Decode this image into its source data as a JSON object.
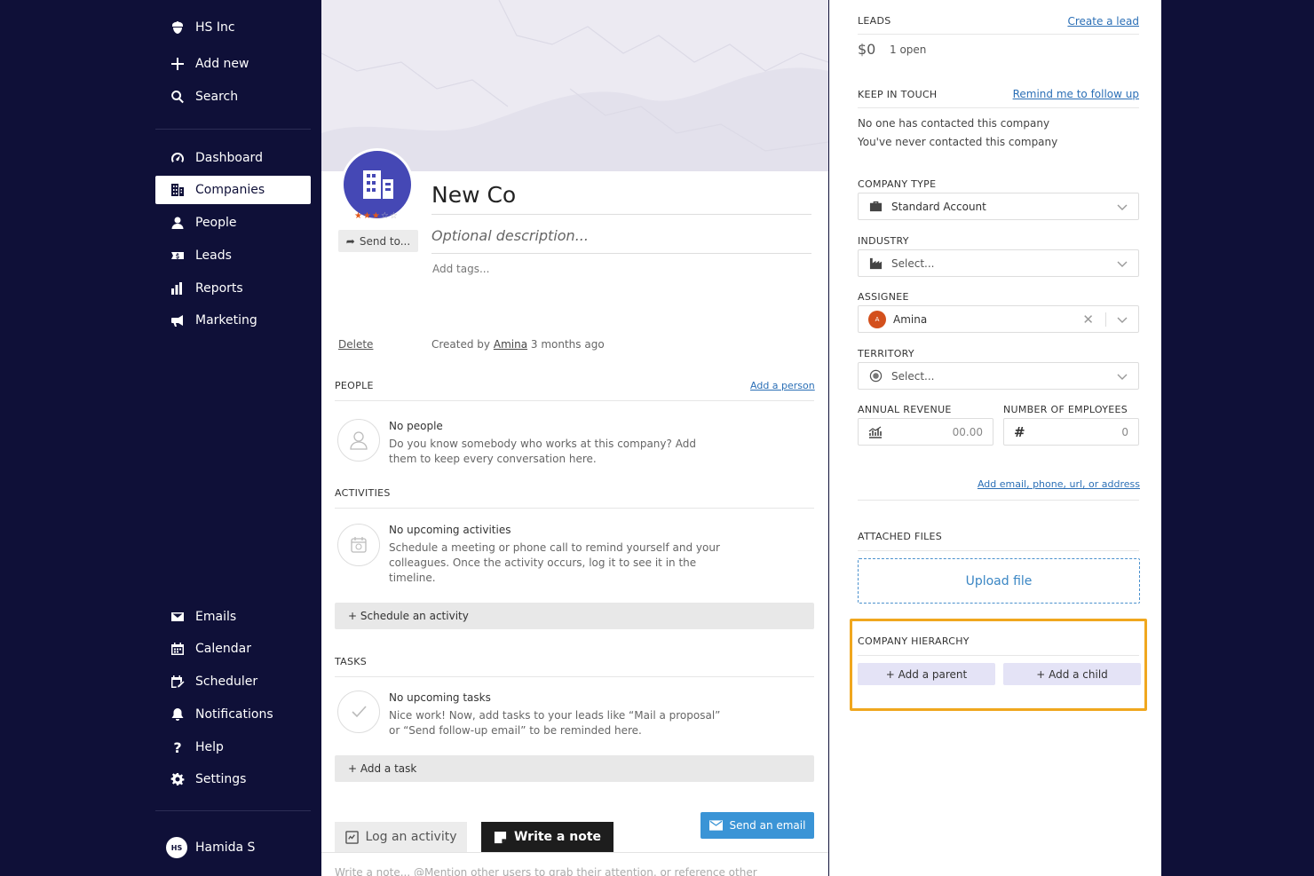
{
  "sidebar": {
    "org": "HS Inc",
    "add_new": "Add new",
    "search": "Search",
    "items": [
      {
        "label": "Dashboard",
        "icon": "dashboard-icon"
      },
      {
        "label": "Companies",
        "icon": "building-icon"
      },
      {
        "label": "People",
        "icon": "person-icon"
      },
      {
        "label": "Leads",
        "icon": "leads-icon"
      },
      {
        "label": "Reports",
        "icon": "bar-chart-icon"
      },
      {
        "label": "Marketing",
        "icon": "megaphone-icon"
      }
    ],
    "bottom_items": [
      {
        "label": "Emails",
        "icon": "envelope-icon"
      },
      {
        "label": "Calendar",
        "icon": "calendar-icon"
      },
      {
        "label": "Scheduler",
        "icon": "scheduler-icon"
      },
      {
        "label": "Notifications",
        "icon": "bell-icon"
      },
      {
        "label": "Help",
        "icon": "question-icon"
      },
      {
        "label": "Settings",
        "icon": "gear-icon"
      }
    ],
    "user_initials": "HS",
    "user_name": "Hamida S"
  },
  "company": {
    "name": "New Co",
    "description_placeholder": "Optional description...",
    "tags_placeholder": "Add tags...",
    "rating": 3,
    "rating_max": 5,
    "send_to": "Send to...",
    "delete": "Delete",
    "created_prefix": "Created by",
    "created_by": "Amina",
    "created_suffix": "3 months ago"
  },
  "people": {
    "title": "PEOPLE",
    "link": "Add a person",
    "empty_title": "No people",
    "empty_text": "Do you know somebody who works at this company? Add them to keep every conversation here."
  },
  "activities": {
    "title": "ACTIVITIES",
    "empty_title": "No upcoming activities",
    "empty_text": "Schedule a meeting or phone call to remind yourself and your colleagues. Once the activity occurs, log it to see it in the timeline.",
    "button": "+ Schedule an activity"
  },
  "tasks": {
    "title": "TASKS",
    "empty_title": "No upcoming tasks",
    "empty_text": "Nice work! Now, add tasks to your leads like “Mail a proposal” or “Send follow-up email” to be reminded here.",
    "button": "+ Add a task"
  },
  "composer": {
    "log_activity": "Log an activity",
    "write_note": "Write a note",
    "send_email": "Send an email",
    "note_placeholder": "Write a note... @Mention other users to grab their attention, or reference other"
  },
  "right": {
    "leads_label": "LEADS",
    "create_lead": "Create a lead",
    "leads_value": "$0",
    "leads_open": "1 open",
    "keep_in_touch": "KEEP IN TOUCH",
    "remind": "Remind me to follow up",
    "kit_line1": "No one has contacted this company",
    "kit_line2": "You've never contacted this company",
    "company_type_label": "COMPANY TYPE",
    "company_type_value": "Standard Account",
    "industry_label": "INDUSTRY",
    "industry_placeholder": "Select...",
    "assignee_label": "ASSIGNEE",
    "assignee_initial": "A",
    "assignee_value": "Amina",
    "territory_label": "TERRITORY",
    "territory_placeholder": "Select...",
    "revenue_label": "ANNUAL REVENUE",
    "revenue_value": "00.00",
    "employees_label": "NUMBER OF EMPLOYEES",
    "employees_value": "0",
    "add_contact": "Add email, phone, url, or address",
    "files_label": "ATTACHED FILES",
    "upload": "Upload file",
    "hierarchy_label": "COMPANY HIERARCHY",
    "add_parent": "+ Add a parent",
    "add_child": "+ Add a child"
  },
  "colors": {
    "sidebar_bg": "#0f1038",
    "accent": "#4548b5",
    "link": "#2b6fb6",
    "highlight": "#f0a71e"
  }
}
